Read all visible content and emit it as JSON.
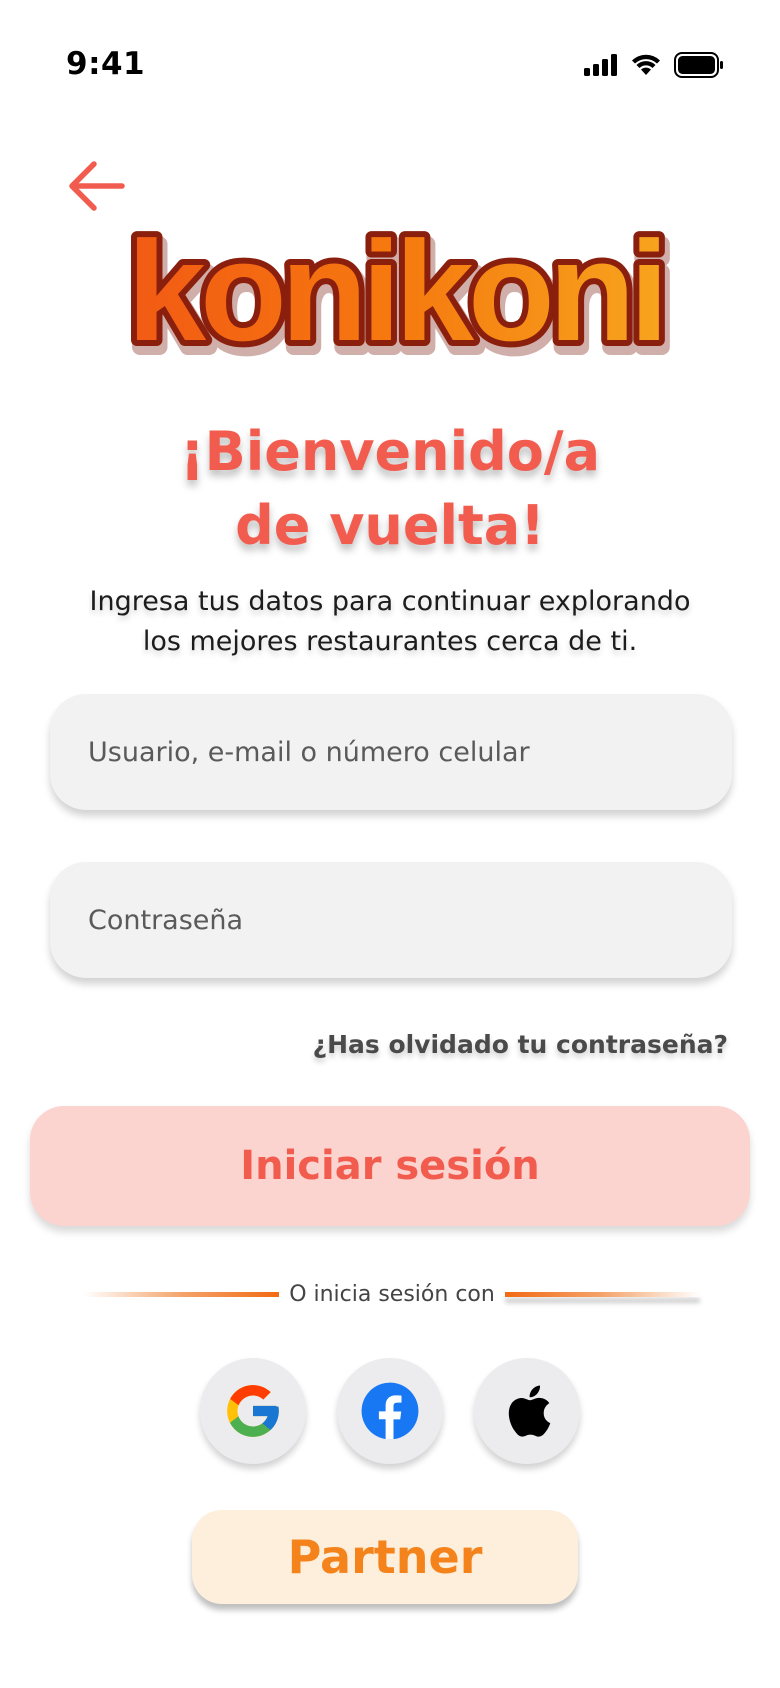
{
  "status_bar": {
    "time": "9:41"
  },
  "brand": {
    "logo_text": "konikoni",
    "accent": "#f25c4f",
    "logo_orange": "#f5831c"
  },
  "header": {
    "title_line1": "¡Bienvenido/a",
    "title_line2": "de vuelta!"
  },
  "subtitle": {
    "line1": "Ingresa tus datos para continuar explorando",
    "line2": "los mejores restaurantes cerca de ti."
  },
  "form": {
    "user_placeholder": "Usuario, e-mail o número celular",
    "password_placeholder": "Contraseña",
    "forgot_label": "¿Has olvidado tu contraseña?",
    "login_label": "Iniciar sesión"
  },
  "social": {
    "divider_label": "O inicia sesión con",
    "providers": [
      "google-icon",
      "facebook-icon",
      "apple-icon"
    ]
  },
  "partner": {
    "label": "Partner"
  },
  "colors": {
    "login_bg": "#fbd3cf",
    "partner_bg": "#fdefdc",
    "field_bg": "#f2f2f2"
  }
}
